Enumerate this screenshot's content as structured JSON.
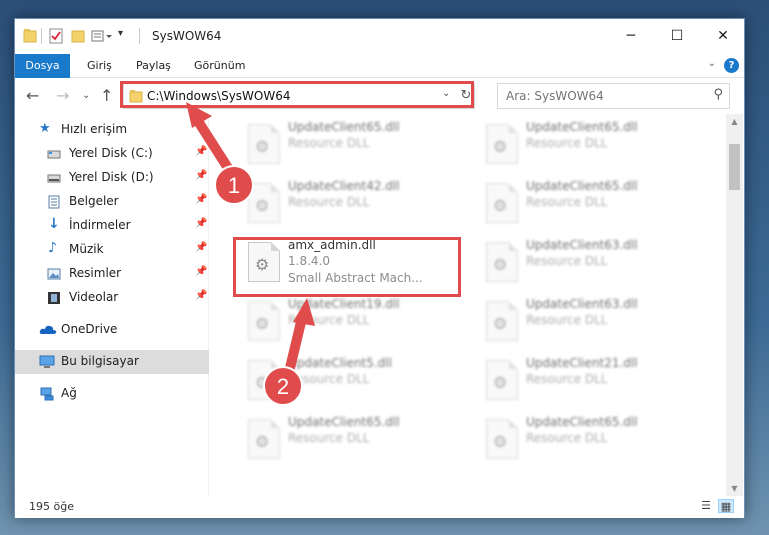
{
  "window": {
    "title": "SysWOW64",
    "minimize": "─",
    "maximize": "☐",
    "close": "✕"
  },
  "ribbon": {
    "tabs": [
      "Dosya",
      "Giriş",
      "Paylaş",
      "Görünüm"
    ],
    "help": "?"
  },
  "nav": {
    "address": "C:\\Windows\\SysWOW64",
    "search_placeholder": "Ara: SysWOW64"
  },
  "sidebar": {
    "items": [
      {
        "label": "Hızlı erişim",
        "icon": "star-icon",
        "pinned": false
      },
      {
        "label": "Yerel Disk (C:)",
        "icon": "drive-icon",
        "pinned": true
      },
      {
        "label": "Yerel Disk (D:)",
        "icon": "drive-icon",
        "pinned": true
      },
      {
        "label": "Belgeler",
        "icon": "documents-icon",
        "pinned": true
      },
      {
        "label": "İndirmeler",
        "icon": "download-icon",
        "pinned": true
      },
      {
        "label": "Müzik",
        "icon": "music-icon",
        "pinned": true
      },
      {
        "label": "Resimler",
        "icon": "pictures-icon",
        "pinned": true
      },
      {
        "label": "Videolar",
        "icon": "video-icon",
        "pinned": true
      },
      {
        "label": "OneDrive",
        "icon": "cloud-icon",
        "pinned": false
      },
      {
        "label": "Bu bilgisayar",
        "icon": "computer-icon",
        "pinned": false,
        "selected": true
      },
      {
        "label": "Ağ",
        "icon": "network-icon",
        "pinned": false
      }
    ]
  },
  "files": {
    "left": [
      {
        "name": "UpdateClient65.dll",
        "desc": "Resource DLL"
      },
      {
        "name": "UpdateClient42.dll",
        "desc": "Resource DLL"
      },
      {
        "name": "amx_admin.dll",
        "desc": "1.8.4.0",
        "extra": "Small Abstract Mach..."
      },
      {
        "name": "UpdateClient19.dll",
        "desc": "Resource DLL"
      },
      {
        "name": "UpdateClient5.dll",
        "desc": "Resource DLL"
      },
      {
        "name": "UpdateClient65.dll",
        "desc": "Resource DLL"
      }
    ],
    "right": [
      {
        "name": "UpdateClient65.dll",
        "desc": "Resource DLL"
      },
      {
        "name": "UpdateClient65.dll",
        "desc": "Resource DLL"
      },
      {
        "name": "UpdateClient63.dll",
        "desc": "Resource DLL"
      },
      {
        "name": "UpdateClient63.dll",
        "desc": "Resource DLL"
      },
      {
        "name": "UpdateClient21.dll",
        "desc": "Resource DLL"
      },
      {
        "name": "UpdateClient65.dll",
        "desc": "Resource DLL"
      }
    ]
  },
  "status": {
    "item_count": "195 öğe"
  },
  "annotations": {
    "step1": "1",
    "step2": "2",
    "color": "#e04b4b"
  }
}
